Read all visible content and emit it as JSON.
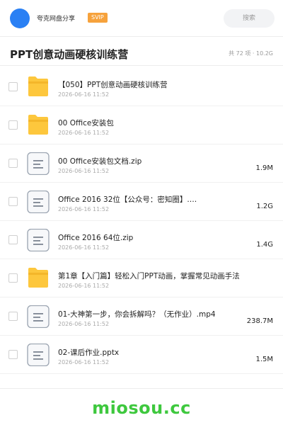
{
  "header": {
    "share_name": "夸克网盘分享",
    "badge": "SVIP",
    "search_placeholder": "搜索"
  },
  "folder": {
    "title": "PPT创意动画硬核训练营",
    "meta": "共 72 项 · 10.2G"
  },
  "files": [
    {
      "name": "【050】PPT创意动画硬核训练营",
      "date": "2026-06-16 11:52",
      "size": "",
      "type": "folder"
    },
    {
      "name": "00 Office安装包",
      "date": "2026-06-16 11:52",
      "size": "",
      "type": "folder"
    },
    {
      "name": "00 Office安装包文档.zip",
      "date": "2026-06-16 11:52",
      "size": "1.9M",
      "type": "file"
    },
    {
      "name": "Office 2016 32位【公众号：密知圈】.…",
      "date": "2026-06-16 11:52",
      "size": "1.2G",
      "type": "file"
    },
    {
      "name": "Office 2016 64位.zip",
      "date": "2026-06-16 11:52",
      "size": "1.4G",
      "type": "file"
    },
    {
      "name": "第1章【入门篇】轻松入门PPT动画，掌握常见动画手法",
      "date": "2026-06-16 11:52",
      "size": "",
      "type": "folder"
    },
    {
      "name": "01-大神第一步，你会拆解吗？（无作业）.mp4",
      "date": "2026-06-16 11:52",
      "size": "238.7M",
      "type": "file"
    },
    {
      "name": "02-课后作业.pptx",
      "date": "2026-06-16 11:52",
      "size": "1.5M",
      "type": "file"
    }
  ],
  "colors": {
    "folder_yellow": "#fdc73d",
    "accent_blue": "#2a80f4",
    "svip_orange": "#f6a23c",
    "watermark_green": "#3ec83e"
  },
  "watermark": "miosou.cc"
}
